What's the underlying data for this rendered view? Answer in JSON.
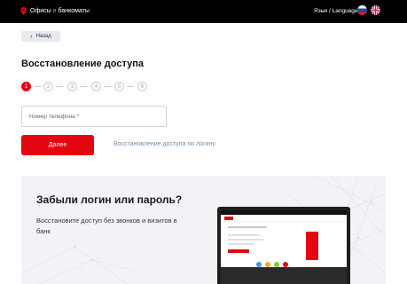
{
  "header": {
    "offices_label": "Офисы",
    "separator": "и",
    "atms_label": "банкоматы",
    "language_label": "Язык / Language"
  },
  "back_button": {
    "label": "Назад"
  },
  "page_title": "Восстановление доступа",
  "stepper": {
    "steps": [
      "1",
      "2",
      "3",
      "4",
      "5",
      "6"
    ],
    "active_step": 1
  },
  "form": {
    "phone_placeholder": "Номер телефона *",
    "phone_value": "",
    "next_button_label": "Далее",
    "login_recovery_link": "Восстановление доступа по логину"
  },
  "promo": {
    "title": "Забыли логин или пароль?",
    "text": "Восстановите доступ без звонков и визитов в банк"
  },
  "colors": {
    "brand_red": "#e30611",
    "header_bg": "#000000",
    "link_blue": "#6b8fb3",
    "promo_bg": "#f2f3f7"
  },
  "icons": {
    "location": "map-pin-icon",
    "back": "chevron-left-icon",
    "language_ru": "russia-flag-icon",
    "language_en": "uk-flag-icon"
  }
}
